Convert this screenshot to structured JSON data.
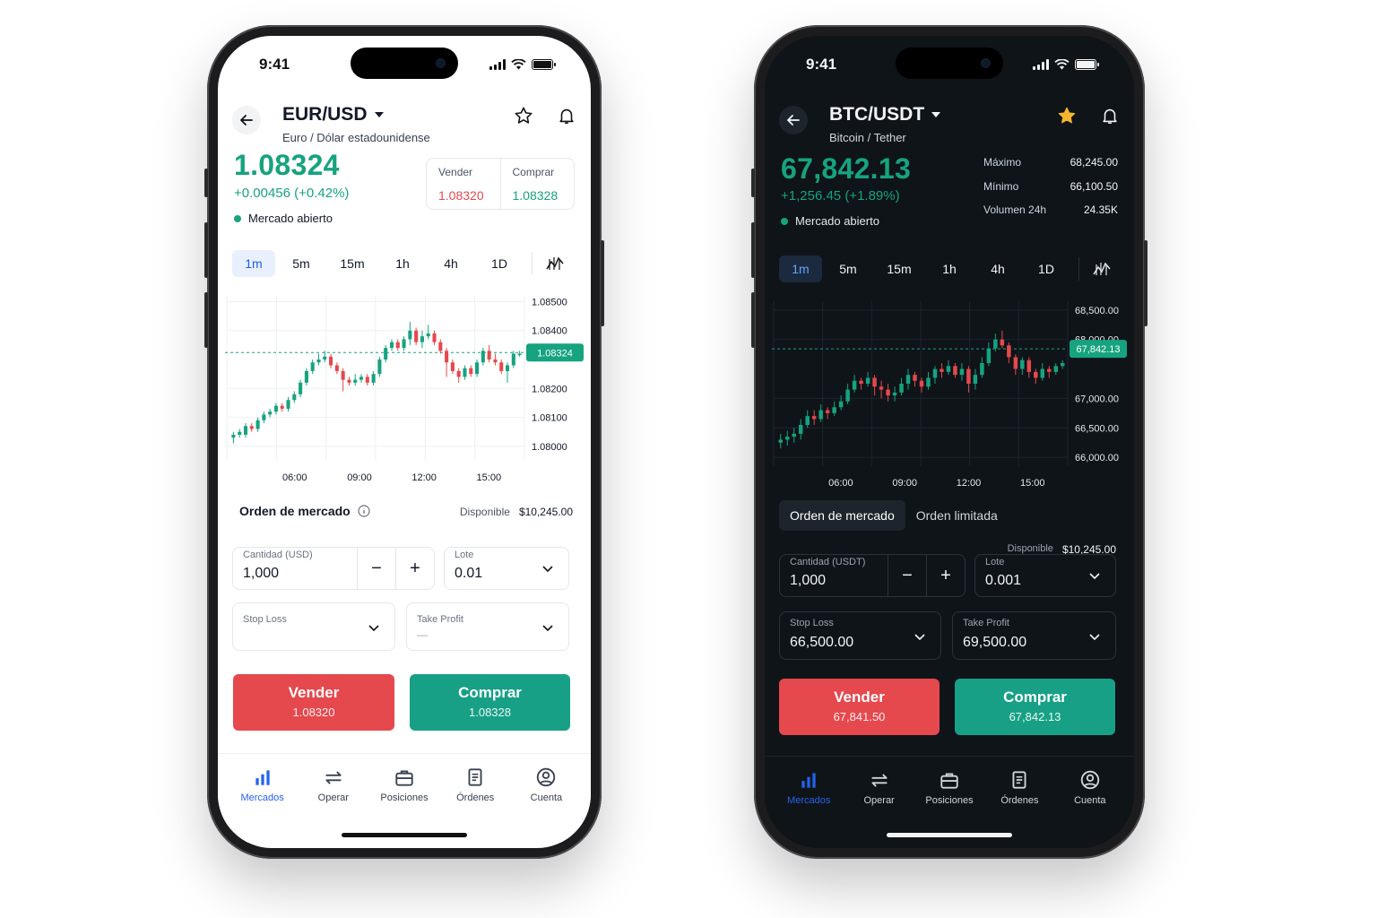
{
  "light": {
    "status_time": "9:41",
    "pair": "EUR/USD",
    "pair_name": "Euro / Dólar estadounidense",
    "price": "1.08324",
    "change": "+0.00456 (+0.42%)",
    "market_status": "Mercado abierto",
    "bid_label": "Vender",
    "bid": "1.08320",
    "ask_label": "Comprar",
    "ask": "1.08328",
    "timeframes": [
      "1m",
      "5m",
      "15m",
      "1h",
      "4h",
      "1D"
    ],
    "active_timeframe": "1m",
    "order_title": "Orden de mercado",
    "available_label": "Disponible",
    "available": "$10,245.00",
    "amount_label": "Cantidad (USD)",
    "amount": "1,000",
    "lot_label": "Lote",
    "lot": "0.01",
    "stop_loss_label": "Stop Loss",
    "take_profit_label": "Take Profit",
    "take_profit_value": "—",
    "sell_label": "Vender",
    "sell_price": "1.08320",
    "buy_label": "Comprar",
    "buy_price": "1.08328",
    "tabs": [
      "Mercados",
      "Operar",
      "Posiciones",
      "Órdenes",
      "Cuenta"
    ],
    "chart_data": {
      "type": "candlestick",
      "x_ticks": [
        "06:00",
        "09:00",
        "12:00",
        "15:00"
      ],
      "y_ticks": [
        "1.08500",
        "1.08400",
        "1.08200",
        "1.08100",
        "1.08000"
      ],
      "ylim": [
        1.0795,
        1.0852
      ],
      "current_price": 1.08324,
      "current_label": "1.08324",
      "colors": {
        "up": "#16a37f",
        "down": "#e5484d"
      },
      "candles": [
        [
          1.0803,
          1.0804,
          1.0805,
          1.0801
        ],
        [
          1.0804,
          1.0805,
          1.0806,
          1.0803
        ],
        [
          1.0804,
          1.0807,
          1.0808,
          1.0803
        ],
        [
          1.0807,
          1.0806,
          1.0808,
          1.0805
        ],
        [
          1.0806,
          1.0809,
          1.081,
          1.0805
        ],
        [
          1.0809,
          1.0811,
          1.0812,
          1.0808
        ],
        [
          1.0811,
          1.0812,
          1.0813,
          1.081
        ],
        [
          1.0812,
          1.0814,
          1.0815,
          1.0811
        ],
        [
          1.0814,
          1.0813,
          1.0815,
          1.0812
        ],
        [
          1.0813,
          1.0816,
          1.0817,
          1.0812
        ],
        [
          1.0816,
          1.0818,
          1.0819,
          1.0815
        ],
        [
          1.0818,
          1.0822,
          1.0823,
          1.0817
        ],
        [
          1.0822,
          1.0826,
          1.0827,
          1.0821
        ],
        [
          1.0826,
          1.0829,
          1.083,
          1.0825
        ],
        [
          1.0829,
          1.083,
          1.0832,
          1.0828
        ],
        [
          1.083,
          1.0831,
          1.0833,
          1.0829
        ],
        [
          1.0831,
          1.0828,
          1.0832,
          1.0827
        ],
        [
          1.0828,
          1.0826,
          1.0829,
          1.0825
        ],
        [
          1.0826,
          1.0823,
          1.0827,
          1.0819
        ],
        [
          1.0823,
          1.0822,
          1.0824,
          1.0821
        ],
        [
          1.0822,
          1.0823,
          1.0825,
          1.0821
        ],
        [
          1.0823,
          1.0824,
          1.0825,
          1.0822
        ],
        [
          1.0824,
          1.0822,
          1.0825,
          1.0821
        ],
        [
          1.0822,
          1.0825,
          1.0826,
          1.0821
        ],
        [
          1.0825,
          1.083,
          1.0831,
          1.0824
        ],
        [
          1.083,
          1.0834,
          1.0835,
          1.0829
        ],
        [
          1.0834,
          1.0836,
          1.0837,
          1.0833
        ],
        [
          1.0836,
          1.0834,
          1.0837,
          1.0833
        ],
        [
          1.0834,
          1.0837,
          1.0838,
          1.0833
        ],
        [
          1.0837,
          1.084,
          1.0843,
          1.0835
        ],
        [
          1.084,
          1.0836,
          1.0841,
          1.0835
        ],
        [
          1.0836,
          1.0838,
          1.084,
          1.0834
        ],
        [
          1.0838,
          1.0839,
          1.0842,
          1.0837
        ],
        [
          1.0839,
          1.0836,
          1.084,
          1.0835
        ],
        [
          1.0836,
          1.0833,
          1.0837,
          1.0832
        ],
        [
          1.0833,
          1.0829,
          1.0834,
          1.0824
        ],
        [
          1.0829,
          1.0826,
          1.083,
          1.0825
        ],
        [
          1.0826,
          1.0824,
          1.0827,
          1.0822
        ],
        [
          1.0824,
          1.0827,
          1.0828,
          1.0823
        ],
        [
          1.0827,
          1.0825,
          1.0828,
          1.0824
        ],
        [
          1.0825,
          1.0829,
          1.083,
          1.0824
        ],
        [
          1.0829,
          1.0833,
          1.0834,
          1.0828
        ],
        [
          1.0833,
          1.083,
          1.0835,
          1.0829
        ],
        [
          1.083,
          1.0829,
          1.0832,
          1.0828
        ],
        [
          1.0829,
          1.0826,
          1.083,
          1.0825
        ],
        [
          1.0826,
          1.0828,
          1.0829,
          1.0822
        ],
        [
          1.0828,
          1.0832,
          1.0833,
          1.0827
        ],
        [
          1.0832,
          1.0832,
          1.0833,
          1.0831
        ]
      ]
    }
  },
  "dark": {
    "status_time": "9:41",
    "pair": "BTC/USDT",
    "pair_name": "Bitcoin / Tether",
    "price": "67,842.13",
    "change": "+1,256.45 (+1.89%)",
    "market_status": "Mercado abierto",
    "stats": [
      {
        "label": "Máximo",
        "value": "68,245.00"
      },
      {
        "label": "Mínimo",
        "value": "66,100.50"
      },
      {
        "label": "Volumen 24h",
        "value": "24.35K"
      }
    ],
    "timeframes": [
      "1m",
      "5m",
      "15m",
      "1h",
      "4h",
      "1D"
    ],
    "active_timeframe": "1m",
    "order_tabs": [
      "Orden de mercado",
      "Orden limitada"
    ],
    "available_label": "Disponible",
    "available": "$10,245.00",
    "amount_label": "Cantidad (USDT)",
    "amount": "1,000",
    "lot_label": "Lote",
    "lot": "0.001",
    "stop_loss_label": "Stop Loss",
    "stop_loss": "66,500.00",
    "take_profit_label": "Take Profit",
    "take_profit": "69,500.00",
    "sell_label": "Vender",
    "sell_price": "67,841.50",
    "buy_label": "Comprar",
    "buy_price": "67,842.13",
    "tabs": [
      "Mercados",
      "Operar",
      "Posiciones",
      "Órdenes",
      "Cuenta"
    ],
    "chart_data": {
      "type": "candlestick",
      "x_ticks": [
        "06:00",
        "09:00",
        "12:00",
        "15:00"
      ],
      "y_ticks": [
        "68,500.00",
        "68,000.00",
        "67,000.00",
        "66,500.00",
        "66,000.00"
      ],
      "ylim": [
        65850,
        68650
      ],
      "current_price": 67842.13,
      "current_label": "67,842.13",
      "colors": {
        "up": "#16a37f",
        "down": "#e5484d"
      },
      "candles": [
        [
          66250,
          66300,
          66400,
          66150
        ],
        [
          66300,
          66350,
          66450,
          66200
        ],
        [
          66350,
          66400,
          66500,
          66250
        ],
        [
          66400,
          66550,
          66650,
          66300
        ],
        [
          66550,
          66700,
          66800,
          66500
        ],
        [
          66700,
          66650,
          66800,
          66550
        ],
        [
          66650,
          66800,
          66900,
          66600
        ],
        [
          66800,
          66750,
          66850,
          66650
        ],
        [
          66750,
          66850,
          66950,
          66700
        ],
        [
          66850,
          66950,
          67050,
          66800
        ],
        [
          66950,
          67150,
          67250,
          66900
        ],
        [
          67150,
          67300,
          67400,
          67100
        ],
        [
          67300,
          67250,
          67350,
          67150
        ],
        [
          67250,
          67350,
          67450,
          67200
        ],
        [
          67350,
          67200,
          67400,
          67050
        ],
        [
          67200,
          67150,
          67300,
          67000
        ],
        [
          67150,
          67050,
          67250,
          66950
        ],
        [
          67050,
          67100,
          67200,
          66950
        ],
        [
          67100,
          67250,
          67350,
          67050
        ],
        [
          67250,
          67400,
          67500,
          67150
        ],
        [
          67400,
          67300,
          67450,
          67200
        ],
        [
          67300,
          67200,
          67350,
          67100
        ],
        [
          67200,
          67350,
          67450,
          67150
        ],
        [
          67350,
          67500,
          67550,
          67250
        ],
        [
          67500,
          67450,
          67600,
          67350
        ],
        [
          67450,
          67550,
          67650,
          67400
        ],
        [
          67550,
          67400,
          67600,
          67350
        ],
        [
          67400,
          67500,
          67600,
          67300
        ],
        [
          67500,
          67250,
          67550,
          67100
        ],
        [
          67250,
          67400,
          67500,
          67150
        ],
        [
          67400,
          67600,
          67700,
          67350
        ],
        [
          67600,
          67850,
          67950,
          67550
        ],
        [
          67850,
          68000,
          68100,
          67800
        ],
        [
          68000,
          67900,
          68150,
          67850
        ],
        [
          67900,
          67700,
          67950,
          67600
        ],
        [
          67700,
          67500,
          67750,
          67400
        ],
        [
          67500,
          67650,
          67700,
          67400
        ],
        [
          67650,
          67450,
          67700,
          67350
        ],
        [
          67450,
          67350,
          67500,
          67250
        ],
        [
          67350,
          67500,
          67600,
          67300
        ],
        [
          67500,
          67450,
          67550,
          67350
        ],
        [
          67450,
          67550,
          67600,
          67400
        ],
        [
          67550,
          67600,
          67650,
          67500
        ]
      ]
    }
  }
}
